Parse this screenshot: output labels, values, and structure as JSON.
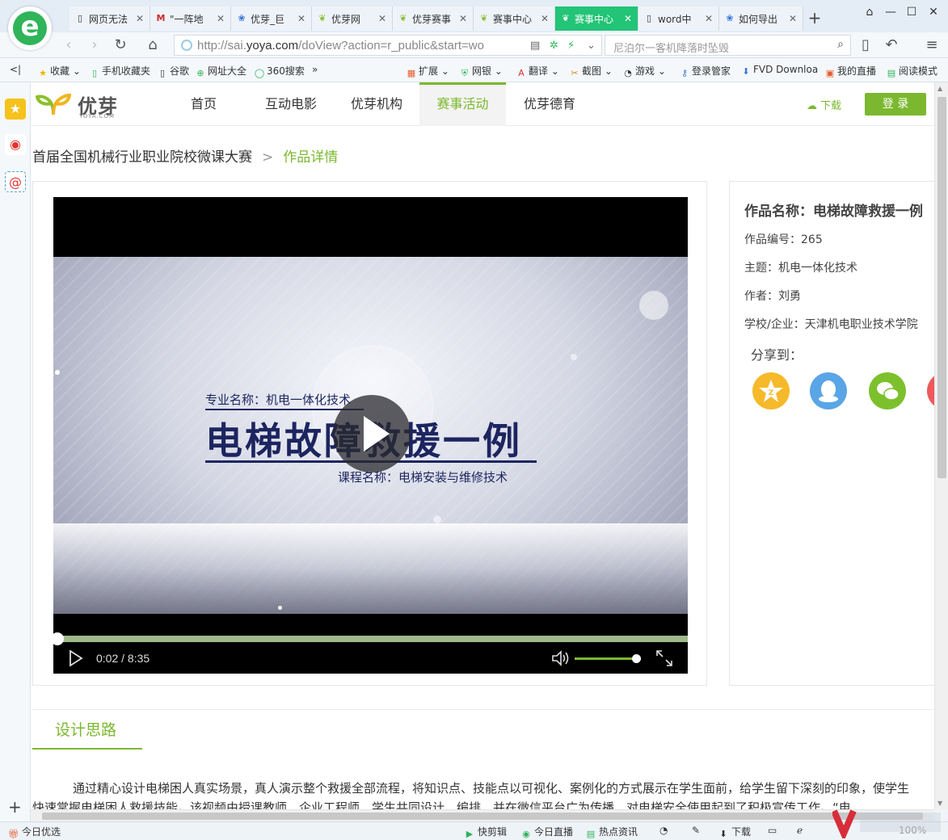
{
  "browser": {
    "tabs": [
      {
        "title": "网页无法",
        "icon": "doc-icon",
        "active": false
      },
      {
        "title": "\"一阵地",
        "icon": "m-logo-icon",
        "active": false
      },
      {
        "title": "优芽_巨",
        "icon": "paw-icon",
        "active": false
      },
      {
        "title": "优芽网",
        "icon": "sprout-icon",
        "active": false
      },
      {
        "title": "优芽赛事",
        "icon": "sprout-icon",
        "active": false
      },
      {
        "title": "赛事中心",
        "icon": "sprout-icon",
        "active": false
      },
      {
        "title": "赛事中心",
        "icon": "sprout-icon",
        "active": true
      },
      {
        "title": "word中",
        "icon": "doc-icon",
        "active": false
      },
      {
        "title": "如何导出",
        "icon": "paw-icon",
        "active": false
      }
    ],
    "address": {
      "prefix": "http://sai.",
      "domain": "yoya.com",
      "path": "/doView?action=r_public&start=wo"
    },
    "search_placeholder": "尼泊尔一客机降落时坠毁",
    "bookmarks": [
      {
        "label": "收藏",
        "icon": "star-icon"
      },
      {
        "label": "手机收藏夹",
        "icon": "phone-icon"
      },
      {
        "label": "谷歌",
        "icon": "doc-icon"
      },
      {
        "label": "网址大全",
        "icon": "plus-circle-icon"
      },
      {
        "label": "360搜索",
        "icon": "o-circle-icon"
      },
      {
        "label": "扩展",
        "icon": "grid-icon"
      },
      {
        "label": "网银",
        "icon": "shield-icon"
      },
      {
        "label": "翻译",
        "icon": "translate-icon"
      },
      {
        "label": "截图",
        "icon": "scissors-icon"
      },
      {
        "label": "游戏",
        "icon": "gamepad-icon"
      },
      {
        "label": "登录管家",
        "icon": "key-icon"
      },
      {
        "label": "FVD Downloa",
        "icon": "download-arrow-icon"
      },
      {
        "label": "我的直播",
        "icon": "tv-icon"
      },
      {
        "label": "阅读模式",
        "icon": "book-icon"
      }
    ]
  },
  "site": {
    "logo_text": "优芽",
    "logo_domain": "YOYA.COM",
    "nav": [
      {
        "label": "首页",
        "active": false
      },
      {
        "label": "互动电影",
        "active": false
      },
      {
        "label": "优芽机构",
        "active": false
      },
      {
        "label": "赛事活动",
        "active": true
      },
      {
        "label": "优芽德育",
        "active": false
      }
    ],
    "download_label": "下载",
    "login_label": "登 录"
  },
  "breadcrumb": {
    "parent": "首届全国机械行业职业院校微课大赛",
    "separator": ">",
    "current": "作品详情"
  },
  "video": {
    "major_label": "专业名称：机电一体化技术",
    "title": "电梯故障救援一例",
    "course_label": "课程名称：电梯安装与维修技术",
    "time": "0:02 / 8:35",
    "progress": 0.004,
    "volume": 0.93
  },
  "info": {
    "title": "作品名称：电梯故障救援一例",
    "number": "作品编号：265",
    "theme": "主题：机电一体化技术",
    "author": "作者：刘勇",
    "school": "学校/企业：天津机电职业技术学院",
    "share_label": "分享到：",
    "share": [
      {
        "name": "qzone",
        "color": "#f5b92a"
      },
      {
        "name": "qq",
        "color": "#5aa5e6"
      },
      {
        "name": "wechat",
        "color": "#7cc12d"
      },
      {
        "name": "weibo",
        "color": "#ee5a5a"
      }
    ]
  },
  "design": {
    "tab_label": "设计思路",
    "text": "通过精心设计电梯困人真实场景，真人演示整个救援全部流程，将知识点、技能点以可视化、案例化的方式展示在学生面前，给学生留下深刻的印象，使学生快速掌握电梯困人救援技能。该视频由授课教师、企业工程师、学生共同设计、编排，并在微信平台广为传播，对电梯安全使用起到了积极宣传工作。“电"
  },
  "statusbar": {
    "left_label": "今日优选",
    "items": [
      "快剪辑",
      "今日直播",
      "热点资讯",
      "下载"
    ],
    "zoom": "100%"
  }
}
